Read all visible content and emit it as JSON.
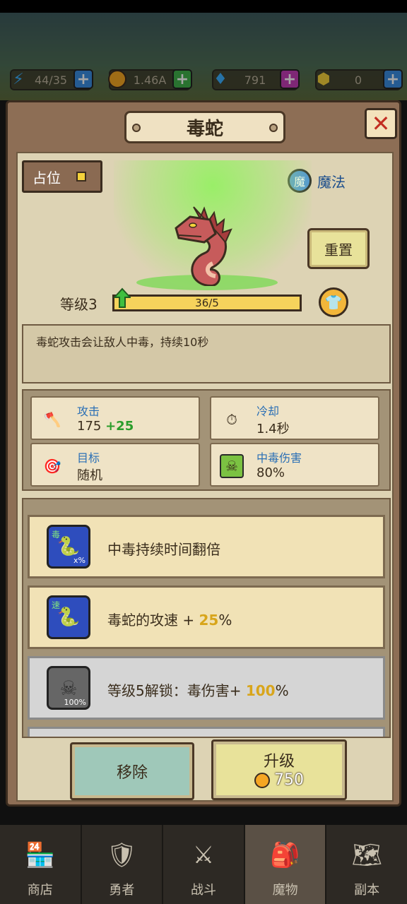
{
  "resources": {
    "energy": {
      "value": "44/35",
      "icon": "lightning-icon"
    },
    "gold": {
      "value": "1.46A",
      "icon": "coin-icon"
    },
    "diamond": {
      "value": "791",
      "icon": "diamond-icon"
    },
    "gem": {
      "value": "0",
      "icon": "gem-icon"
    },
    "plus": "+"
  },
  "dialog": {
    "title": "毒蛇",
    "close": "✕",
    "place_label": "占位",
    "type_badge": "魔",
    "type_label": "魔法",
    "reset_label": "重置",
    "level_label": "等级3",
    "xp_text": "36/5",
    "description": "毒蛇攻击会让敌人中毒，持续10秒"
  },
  "stats": {
    "attack": {
      "label": "攻击",
      "base": "175",
      "bonus": "+25"
    },
    "cooldown": {
      "label": "冷却",
      "value": "1.4秒"
    },
    "target": {
      "label": "目标",
      "value": "随机"
    },
    "poison": {
      "label": "中毒伤害",
      "value": "80%"
    }
  },
  "skills": [
    {
      "badge": "毒",
      "sub": "x%",
      "text": "中毒持续时间翻倍"
    },
    {
      "badge": "速",
      "text_a": "毒蛇的攻速 + ",
      "highlight": "25",
      "text_b": "%"
    },
    {
      "sub": "100%",
      "text_a": "等级5解锁：毒伤害+ ",
      "highlight": "100",
      "text_b": "%"
    }
  ],
  "buttons": {
    "remove": "移除",
    "upgrade": "升级",
    "upgrade_cost": "750"
  },
  "nav": [
    {
      "label": "商店",
      "icon": "shop-icon"
    },
    {
      "label": "勇者",
      "icon": "hero-icon"
    },
    {
      "label": "战斗",
      "icon": "battle-icon"
    },
    {
      "label": "魔物",
      "icon": "monster-bag-icon",
      "active": true
    },
    {
      "label": "副本",
      "icon": "map-icon"
    }
  ],
  "colors": {
    "accent_gold": "#f6d35c",
    "panel": "#ddd3b4",
    "stat_label_blue": "#2a6fb5",
    "bonus_green": "#2b9d2b"
  }
}
